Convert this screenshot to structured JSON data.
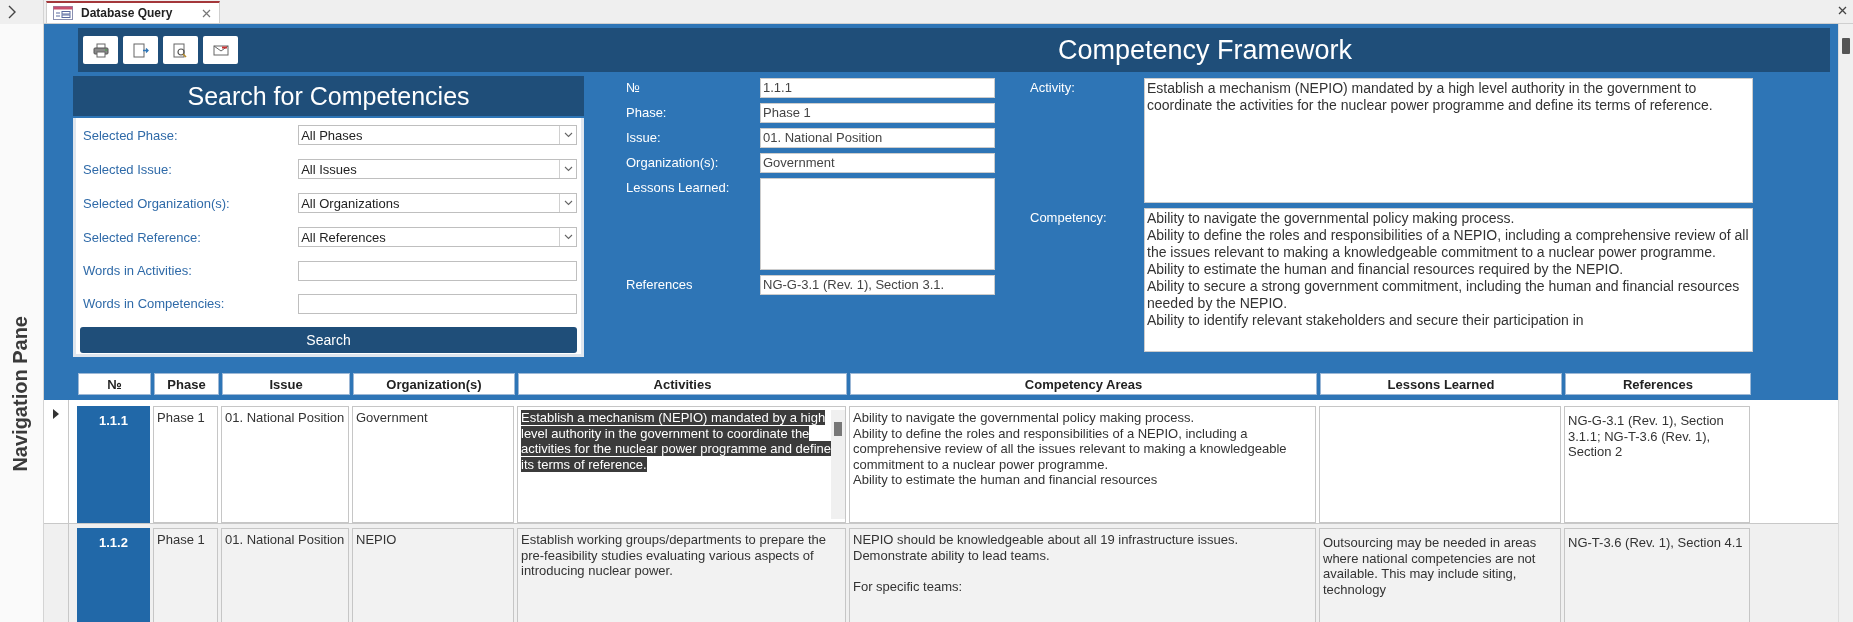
{
  "nav_pane": {
    "label": "Navigation Pane"
  },
  "tabs": [
    {
      "label": "Database Query",
      "selected": true
    }
  ],
  "header": {
    "title": "Competency Framework"
  },
  "search_panel": {
    "title": "Search for Competencies",
    "filters": [
      {
        "kind": "dropdown",
        "label": "Selected Phase:",
        "value": "All Phases"
      },
      {
        "kind": "dropdown",
        "label": "Selected Issue:",
        "value": "All Issues"
      },
      {
        "kind": "dropdown",
        "label": "Selected Organization(s):",
        "value": "All Organizations"
      },
      {
        "kind": "dropdown",
        "label": "Selected Reference:",
        "value": "All References"
      },
      {
        "kind": "text",
        "label": "Words in Activities:"
      },
      {
        "kind": "text",
        "label": "Words in Competencies:"
      }
    ],
    "button": "Search"
  },
  "record": {
    "fields": [
      {
        "kind": "line",
        "label": "№",
        "value": "1.1.1"
      },
      {
        "kind": "line",
        "label": "Phase:",
        "value": "Phase 1"
      },
      {
        "kind": "line",
        "label": "Issue:",
        "value": "01. National Position"
      },
      {
        "kind": "line",
        "label": "Organization(s):",
        "value": "Government"
      },
      {
        "kind": "memo",
        "label": "Lessons Learned:"
      },
      {
        "kind": "line",
        "label": "References",
        "value": "NG-G-3.1 (Rev. 1), Section 3.1."
      }
    ],
    "activity": {
      "label": "Activity:",
      "value": "Establish a mechanism (NEPIO) mandated by a high level authority in the government to coordinate the activities for the nuclear power programme and define its terms of reference."
    },
    "competency": {
      "label": "Competency:",
      "value": "Ability to navigate the governmental policy making process.\nAbility to define the roles and responsibilities of a NEPIO, including a comprehensive review of all the issues relevant to making a knowledgeable commitment to a nuclear power programme.\nAbility to estimate the human and financial resources required by the NEPIO.\nAbility to secure a strong government commitment, including the human and financial resources needed by the NEPIO.\nAbility to identify relevant stakeholders and secure their participation in"
    }
  },
  "grid": {
    "columns": [
      "№",
      "Phase",
      "Issue",
      "Organization(s)",
      "Activities",
      "Competency Areas",
      "Lessons Learned",
      "References"
    ],
    "rows": [
      {
        "current": true,
        "no": "1.1.1",
        "phase": "Phase 1",
        "issue": "01. National Position",
        "organization": "Government",
        "activities": "Establish a mechanism (NEPIO) mandated by a high level authority in the government to coordinate the activities for the nuclear power programme and define its terms of reference.",
        "activities_selected": true,
        "competency_areas": "Ability to navigate the governmental policy making process.\nAbility to define the roles and responsibilities of a NEPIO, including a comprehensive review of all the issues relevant to making a knowledgeable commitment to a nuclear power programme.\nAbility to estimate the human and financial resources",
        "references": "NG-G-3.1 (Rev. 1), Section 3.1.1; NG-T-3.6 (Rev. 1), Section 2"
      },
      {
        "current": false,
        "no": "1.1.2",
        "phase": "Phase 1",
        "issue": "01. National Position",
        "organization": "NEPIO",
        "activities": "Establish working groups/departments to prepare the pre-feasibility studies evaluating various aspects of introducing nuclear power.",
        "activities_selected": false,
        "competency_areas": "NEPIO should be knowledgeable about all 19 infrastructure issues.\nDemonstrate ability to lead teams.\n\nFor specific teams:",
        "lessons_learned": "Outsourcing may be needed in areas where national competencies are not available. This may include siting, technology",
        "references": "NG-T-3.6 (Rev. 1), Section 4.1"
      }
    ]
  }
}
